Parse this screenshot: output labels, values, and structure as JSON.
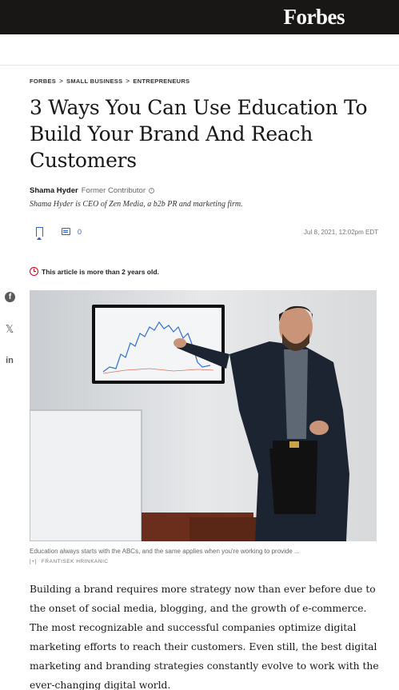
{
  "brand": "Forbes",
  "breadcrumbs": [
    "FORBES",
    "SMALL BUSINESS",
    "ENTREPRENEURS"
  ],
  "breadcrumb_separator": ">",
  "headline": "3 Ways You Can Use Education To Build Your Brand And Reach Customers",
  "author": {
    "name": "Shama Hyder",
    "role": "Former Contributor",
    "info_icon": "i",
    "bio": "Shama Hyder is CEO of Zen Media, a b2b PR and marketing firm."
  },
  "toolbar": {
    "comment_count": "0",
    "date": "Jul 8, 2021, 12:02pm EDT"
  },
  "notice": "This article is more than 2 years old.",
  "social": {
    "facebook": "f",
    "x": "𝕏",
    "linkedin": "in"
  },
  "image": {
    "caption": "Education always starts with the ABCs, and the same applies when you're working to provide ...",
    "expand": "[+]",
    "credit": "FRANTISEK HRINKANIC"
  },
  "body": "Building a brand requires more strategy now than ever before due to the onset of social media, blogging, and the growth of e-commerce. The most recognizable and successful companies optimize digital marketing efforts to reach their customers. Even still, the best digital marketing and branding strategies constantly evolve to work with the ever-changing digital world.",
  "colors": {
    "accent": "#2d64c6",
    "alert": "#d0021b",
    "topbar": "#181716"
  }
}
